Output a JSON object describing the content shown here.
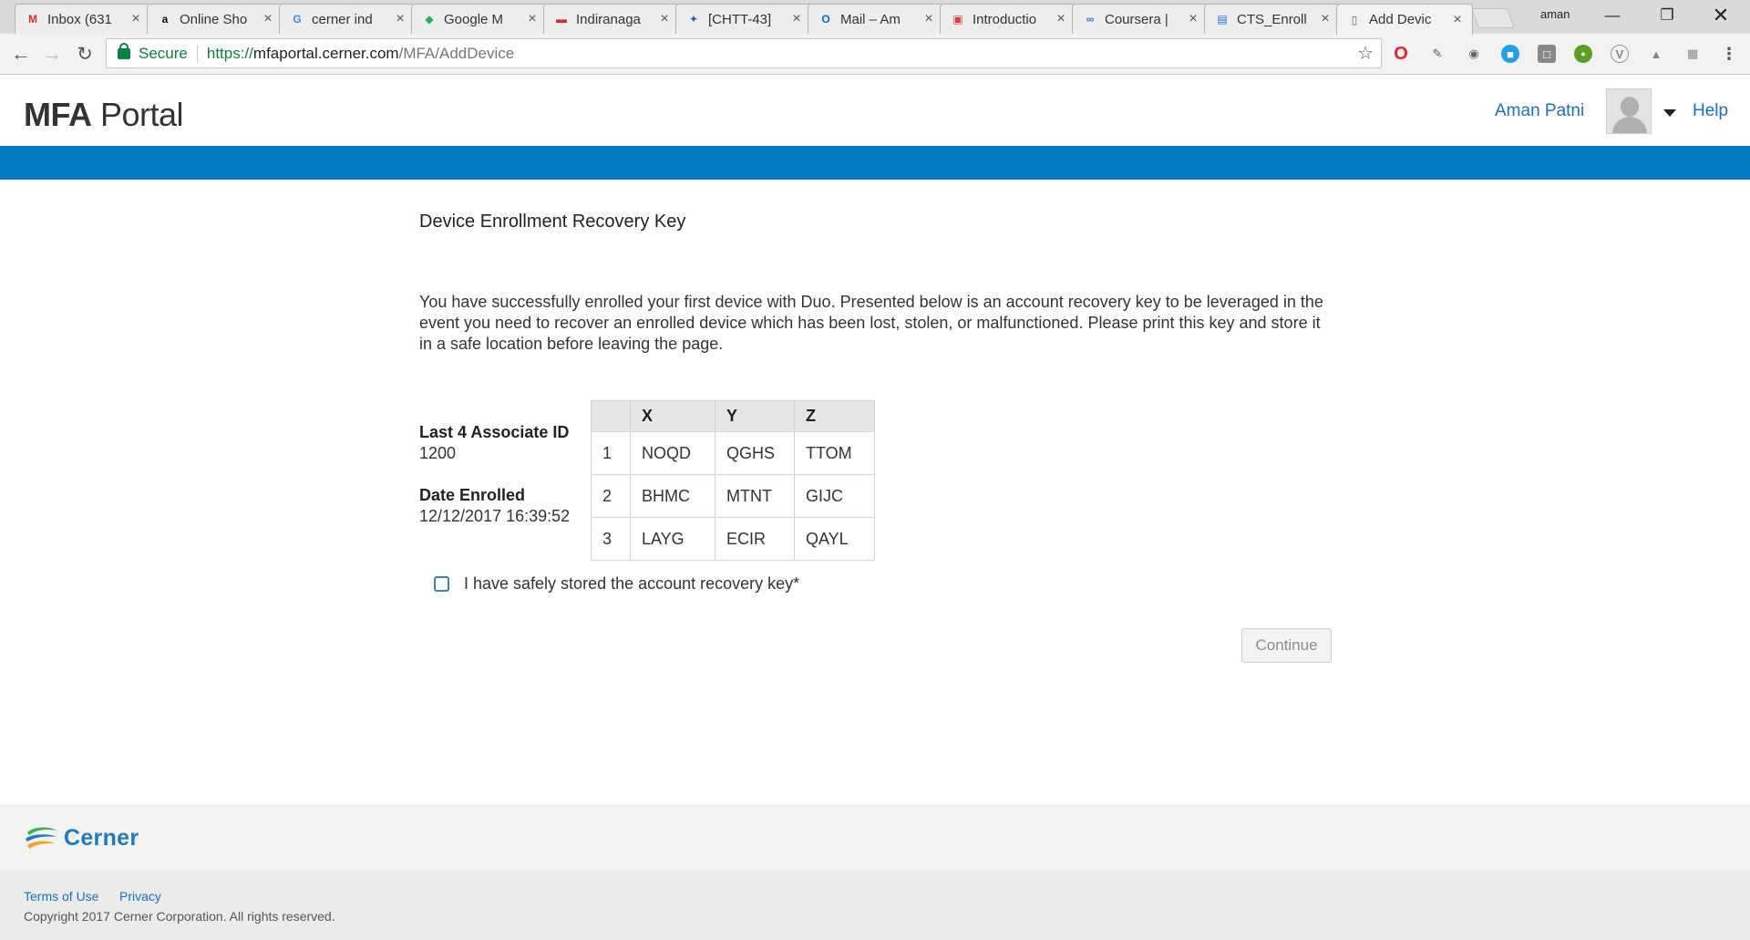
{
  "browser": {
    "tabs": [
      {
        "title": "Inbox (631",
        "icon": "gmail-icon",
        "icon_text": "M",
        "icon_color": "#d93025"
      },
      {
        "title": "Online Sho",
        "icon": "amazon-icon",
        "icon_text": "a",
        "icon_color": "#111111"
      },
      {
        "title": "cerner ind",
        "icon": "google-icon",
        "icon_text": "G",
        "icon_color": "#4285f4"
      },
      {
        "title": "Google M",
        "icon": "maps-icon",
        "icon_text": "◆",
        "icon_color": "#34a853"
      },
      {
        "title": "Indiranaga",
        "icon": "site-icon",
        "icon_text": "▬",
        "icon_color": "#d32f2f"
      },
      {
        "title": "[CHTT-43]",
        "icon": "jira-icon",
        "icon_text": "✦",
        "icon_color": "#2a5caa"
      },
      {
        "title": "Mail – Am",
        "icon": "outlook-icon",
        "icon_text": "O",
        "icon_color": "#0072c6"
      },
      {
        "title": "Introductio",
        "icon": "slides-icon",
        "icon_text": "▣",
        "icon_color": "#e53935"
      },
      {
        "title": "Coursera |",
        "icon": "coursera-icon",
        "icon_text": "∞",
        "icon_color": "#2a73cc"
      },
      {
        "title": "CTS_Enroll",
        "icon": "document-icon",
        "icon_text": "▤",
        "icon_color": "#1a73e8"
      },
      {
        "title": "Add Devic",
        "icon": "page-icon",
        "icon_text": "▯",
        "icon_color": "#666666"
      }
    ],
    "active_tab": 10,
    "profile": "aman",
    "omnibox": {
      "secure_label": "Secure",
      "url_scheme": "https://",
      "url_host": "mfaportal.cerner.com",
      "url_path": "/MFA/AddDevice"
    }
  },
  "header": {
    "logo_bold": "MFA",
    "logo_light": "Portal",
    "user_name": "Aman Patni",
    "help": "Help"
  },
  "content": {
    "heading": "Device Enrollment Recovery Key",
    "intro": "You have successfully enrolled your first device with Duo. Presented below is an account recovery key to be leveraged in the event you need to recover an enrolled device which has been lost, stolen, or malfunctioned. Please print this key and store it in a safe location before leaving the page.",
    "associate_label": "Last 4 Associate ID",
    "associate_value": "1200",
    "date_label": "Date Enrolled",
    "date_value": "12/12/2017 16:39:52",
    "table": {
      "columns": [
        "",
        "X",
        "Y",
        "Z"
      ],
      "rows": [
        [
          "1",
          "NOQD",
          "QGHS",
          "TTOM"
        ],
        [
          "2",
          "BHMC",
          "MTNT",
          "GIJC"
        ],
        [
          "3",
          "LAYG",
          "ECIR",
          "QAYL"
        ]
      ]
    },
    "checkbox_label": "I have safely stored the account recovery key*",
    "continue_label": "Continue"
  },
  "footer": {
    "brand": "Cerner",
    "terms": "Terms of Use",
    "privacy": "Privacy",
    "copyright": "Copyright 2017 Cerner Corporation. All rights reserved."
  },
  "colors": {
    "accent_bar": "#0079c1",
    "link": "#1a6fc0",
    "secure_green": "#0b8043"
  }
}
